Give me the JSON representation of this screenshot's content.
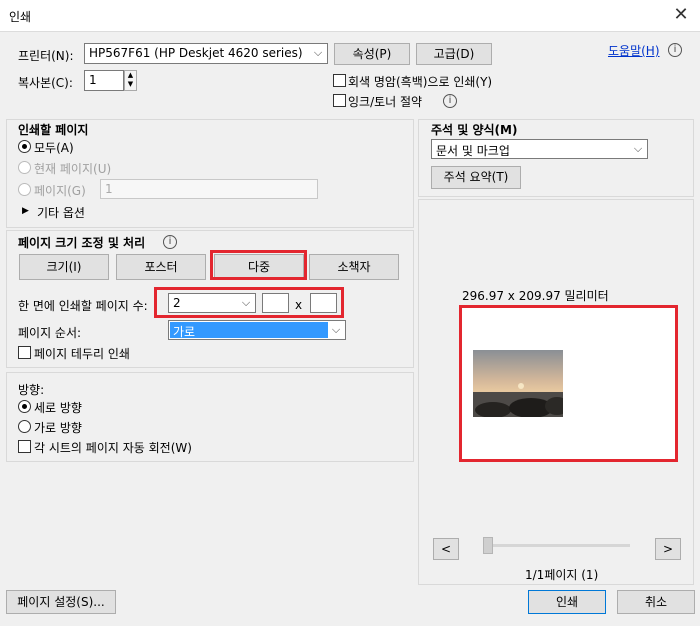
{
  "window": {
    "title": "인쇄",
    "close_glyph": "✕"
  },
  "printer": {
    "label": "프린터(N):",
    "selected": "HP567F61 (HP Deskjet 4620 series)",
    "properties_button": "속성(P)",
    "advanced_button": "고급(D)",
    "help_link": "도움말(H)"
  },
  "copies": {
    "label": "복사본(C):",
    "value": "1"
  },
  "options": {
    "grayscale": "회색 명암(흑백)으로 인쇄(Y)",
    "save_ink": "잉크/토너 절약"
  },
  "pages_to_print": {
    "heading": "인쇄할 페이지",
    "all": "모두(A)",
    "current": "현재 페이지(U)",
    "pages": "페이지(G)",
    "pages_value": "1",
    "more_options": "기타 옵션"
  },
  "page_sizing": {
    "heading": "페이지 크기 조정 및 처리",
    "tabs": [
      "크기(I)",
      "포스터",
      "다중",
      "소책자"
    ],
    "pages_per_sheet_label": "한 면에 인쇄할 페이지 수:",
    "pages_per_sheet_value": "2",
    "x_separator": "x",
    "order_label": "페이지 순서:",
    "order_value": "가로",
    "print_border": "페이지 테두리 인쇄"
  },
  "orientation": {
    "heading": "방향:",
    "portrait": "세로 방향",
    "landscape": "가로 방향",
    "auto_rotate": "각 시트의 페이지 자동 회전(W)"
  },
  "comments": {
    "heading": "주석 및 양식(M)",
    "selected": "문서 및 마크업",
    "summarize_button": "주석 요약(T)"
  },
  "preview": {
    "dimensions": "296.97 x 209.97 밀리미터",
    "prev": "<",
    "next": ">",
    "page_indicator": "1/1페이지 (1)"
  },
  "footer": {
    "page_setup": "페이지 설정(S)...",
    "print": "인쇄",
    "cancel": "취소"
  },
  "colors": {
    "highlight": "#e3262f",
    "selection": "#3399ff"
  }
}
